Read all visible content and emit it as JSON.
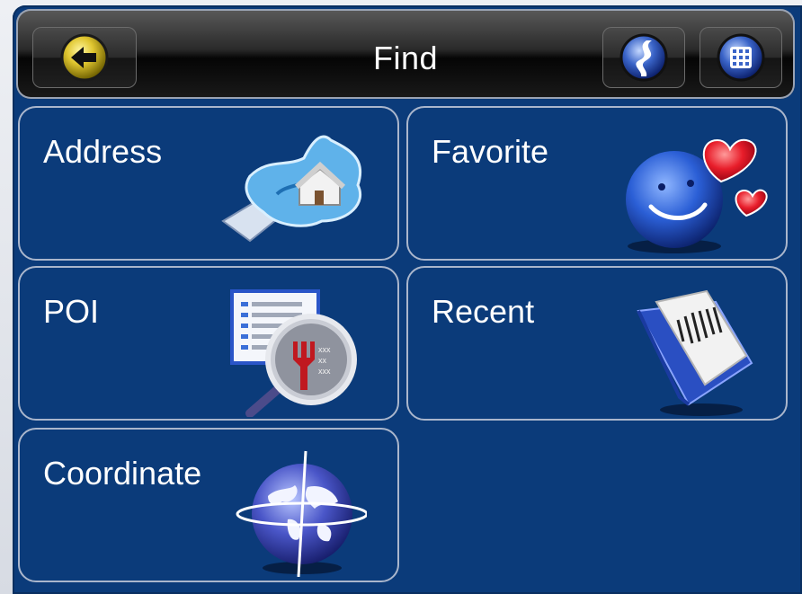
{
  "header": {
    "title": "Find",
    "back_icon": "back-arrow-icon",
    "route_icon": "route-icon",
    "menu_icon": "keypad-menu-icon"
  },
  "tiles": [
    {
      "label": "Address",
      "icon": "map-house-icon"
    },
    {
      "label": "Favorite",
      "icon": "smiley-hearts-icon"
    },
    {
      "label": "POI",
      "icon": "poi-magnifier-icon"
    },
    {
      "label": "Recent",
      "icon": "recent-book-icon"
    },
    {
      "label": "Coordinate",
      "icon": "globe-icon"
    }
  ],
  "colors": {
    "screen_bg": "#0b3b7a",
    "tile_border": "#aab6cc",
    "title_text": "#ffffff"
  }
}
